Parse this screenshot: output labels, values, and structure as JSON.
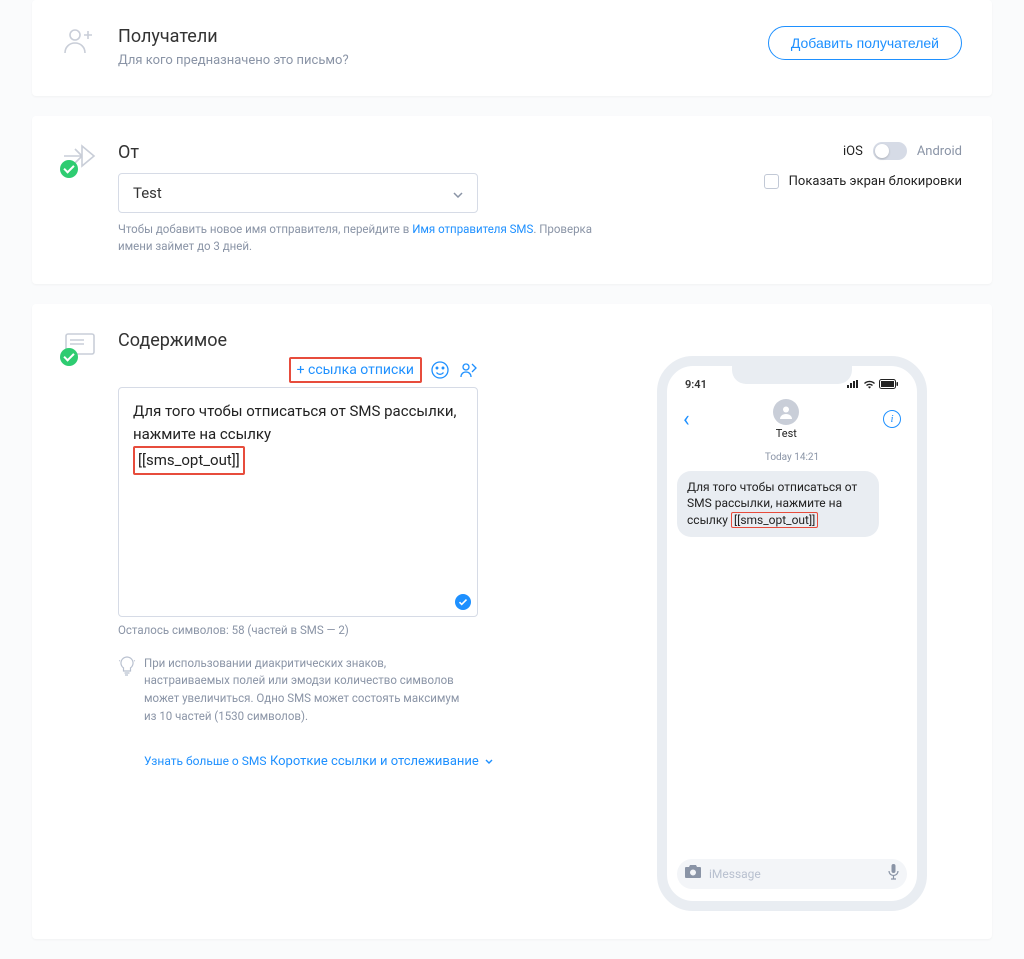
{
  "recipients": {
    "title": "Получатели",
    "subtitle": "Для кого предназначено это письмо?",
    "add_button": "Добавить получателей"
  },
  "from": {
    "title": "От",
    "selected_sender": "Test",
    "hint_prefix": "Чтобы добавить новое имя отправителя, перейдите в ",
    "hint_link": "Имя отправителя SMS",
    "hint_suffix": ". Проверка имени займет до 3 дней."
  },
  "content": {
    "title": "Содержимое",
    "unsub_link_label": "+ ссылка отписки",
    "message_prefix": "Для того чтобы отписаться от SMS рассылки, нажмите на ссылку ",
    "opt_out_token": "[[sms_opt_out]]",
    "counter": "Осталось символов: 58 (частей в SMS — 2)",
    "tip": "При использовании диакритических знаков, настраиваемых полей или эмодзи количество символов может увеличиться. Одно SMS может состоять максимум из 10 частей (1530 символов).",
    "learn_more": "Узнать больше о SMS",
    "short_links": "Короткие ссылки и отслеживание"
  },
  "preview": {
    "ios_label": "iOS",
    "android_label": "Android",
    "lockscreen_label": "Показать экран блокировки",
    "time": "9:41",
    "sender": "Test",
    "timestamp": "Today 14:21",
    "bubble_prefix": "Для того чтобы отписаться от SMS рассылки, нажмите на ссылку ",
    "opt_out_token": "[[sms_opt_out]]",
    "imessage_placeholder": "iMessage"
  }
}
